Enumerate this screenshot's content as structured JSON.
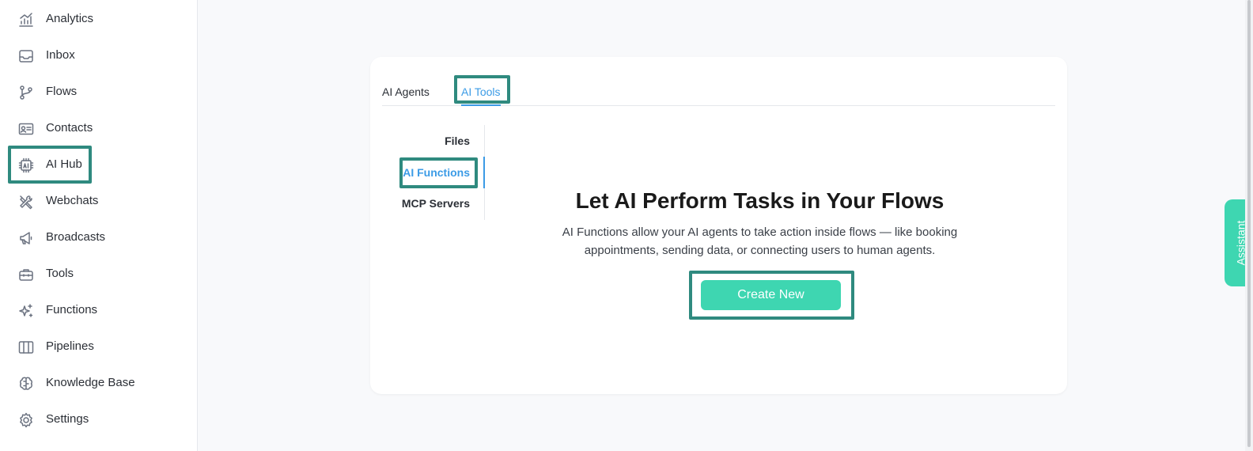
{
  "sidebar": {
    "items": [
      {
        "label": "Analytics",
        "icon": "analytics-icon"
      },
      {
        "label": "Inbox",
        "icon": "inbox-icon"
      },
      {
        "label": "Flows",
        "icon": "flows-icon"
      },
      {
        "label": "Contacts",
        "icon": "contact-card-icon"
      },
      {
        "label": "AI Hub",
        "icon": "ai-chip-icon"
      },
      {
        "label": "Webchats",
        "icon": "tools-cross-icon"
      },
      {
        "label": "Broadcasts",
        "icon": "megaphone-icon"
      },
      {
        "label": "Tools",
        "icon": "toolbox-icon"
      },
      {
        "label": "Functions",
        "icon": "sparkles-icon"
      },
      {
        "label": "Pipelines",
        "icon": "columns-icon"
      },
      {
        "label": "Knowledge Base",
        "icon": "brain-icon"
      },
      {
        "label": "Settings",
        "icon": "gear-icon"
      }
    ]
  },
  "tabs": {
    "agents": "AI Agents",
    "tools": "AI Tools"
  },
  "subnav": {
    "files": "Files",
    "functions": "AI Functions",
    "mcp": "MCP Servers"
  },
  "hero": {
    "title": "Let AI Perform Tasks in Your Flows",
    "description": "AI Functions allow your AI agents to take action inside flows — like booking appointments, sending data, or connecting users to human agents.",
    "button": "Create New"
  },
  "assistant": {
    "label": "Assistant"
  },
  "colors": {
    "accent": "#3ed6b1",
    "link": "#3b9be6",
    "highlight": "#2f8a7f"
  }
}
